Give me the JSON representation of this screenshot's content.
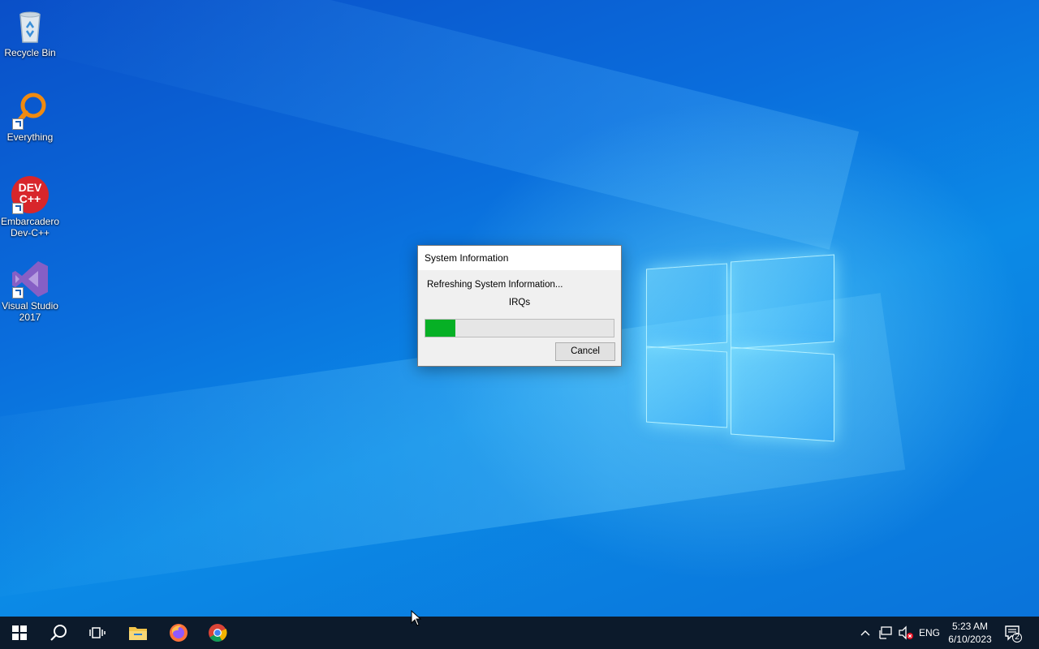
{
  "desktop": {
    "icons": [
      {
        "label": "Recycle Bin",
        "icon": "recycle-bin-icon"
      },
      {
        "label": "Everything",
        "icon": "everything-search-icon"
      },
      {
        "label": "Embarcadero Dev-C++",
        "line1": "Embarcadero",
        "line2": "Dev-C++",
        "icon": "devcpp-icon",
        "badge": "DEV C++"
      },
      {
        "label": "Visual Studio 2017",
        "line1": "Visual Studio",
        "line2": "2017",
        "icon": "visual-studio-icon"
      }
    ]
  },
  "dialog": {
    "title": "System Information",
    "message": "Refreshing System Information...",
    "current_item": "IRQs",
    "progress": 0.16,
    "cancel_label": "Cancel",
    "progress_color": "#06b025"
  },
  "taskbar": {
    "apps": [
      "start-icon",
      "search-icon",
      "task-view-icon",
      "file-explorer-icon",
      "firefox-icon",
      "chrome-icon"
    ],
    "tray": {
      "language": "ENG",
      "time": "5:23 AM",
      "date": "6/10/2023",
      "notification_count": "2"
    }
  }
}
